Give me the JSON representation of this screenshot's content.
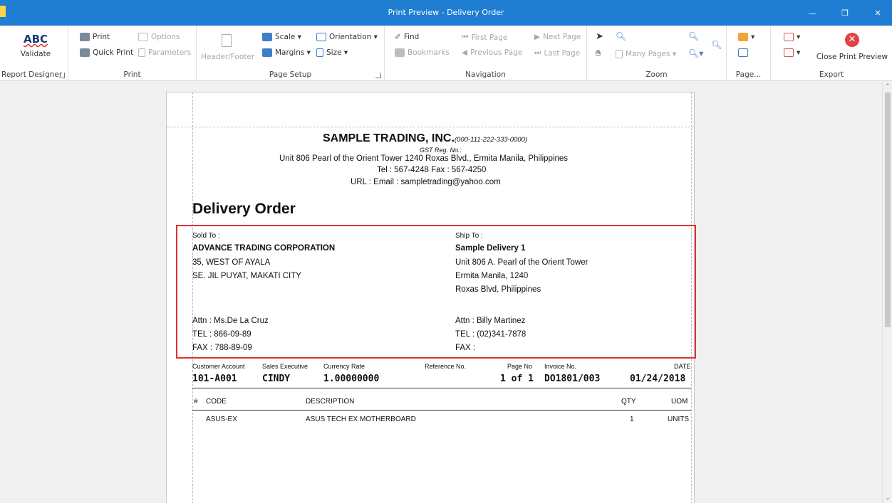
{
  "window": {
    "title": "Print Preview - Delivery Order",
    "controls": {
      "minimize": "—",
      "restore": "❐",
      "close": "✕"
    }
  },
  "ribbon": {
    "groups": {
      "report_designer": {
        "label": "Report Designer",
        "validate_abc": "ABC",
        "validate_label": "Validate"
      },
      "print": {
        "label": "Print",
        "print": "Print",
        "quick_print": "Quick Print",
        "options": "Options",
        "parameters": "Parameters"
      },
      "page_setup": {
        "label": "Page Setup",
        "header_footer": "Header/Footer",
        "scale": "Scale ▾",
        "margins": "Margins ▾",
        "orientation": "Orientation ▾",
        "size": "Size ▾"
      },
      "navigation": {
        "label": "Navigation",
        "find": "Find",
        "bookmarks": "Bookmarks",
        "first_page": "First Page",
        "previous_page": "Previous Page",
        "next_page": "Next Page",
        "last_page": "Last Page"
      },
      "zoom": {
        "label": "Zoom",
        "many_pages": "Many Pages ▾"
      },
      "page_background": {
        "label": "Page..."
      },
      "export": {
        "label": "Export",
        "close_preview": "Close Print Preview"
      }
    }
  },
  "document": {
    "company_name": "SAMPLE TRADING, INC.",
    "company_phone": "(000-111-222-333-0000)",
    "gst": "GST Reg. No.:",
    "address": "Unit 806 Pearl of the Orient Tower 1240 Roxas Blvd., Ermita Manila, Philippines",
    "tel_fax": "Tel : 567-4248  Fax : 567-4250",
    "url_email": "URL :      Email : sampletrading@yahoo.com",
    "title": "Delivery Order",
    "sold_to": {
      "label": "Sold To :",
      "name": "ADVANCE TRADING CORPORATION",
      "line1": "35, WEST OF AYALA",
      "line2": "SE. JIL PUYAT, MAKATI CITY",
      "attn": "Attn : Ms.De La Cruz",
      "tel": "TEL : 866-09-89",
      "fax": "FAX : 788-89-09"
    },
    "ship_to": {
      "label": "Ship To :",
      "name": "Sample Delivery 1",
      "line1": "Unit 806 A. Pearl of the Orient Tower",
      "line2": "Ermita Manila, 1240",
      "line3": "Roxas Blvd, Philippines",
      "attn": "Attn : Billy Martinez",
      "tel": "TEL : (02)341-7878",
      "fax": "FAX :"
    },
    "header": {
      "labels": {
        "customer_account": "Customer Account",
        "sales_executive": "Sales Executive",
        "currency_rate": "Currency Rate",
        "reference_no": "Reference No.",
        "page_no": "Page No",
        "invoice_no": "Invoice No.",
        "date": "DATE"
      },
      "values": {
        "customer_account": "101-A001",
        "sales_executive": "CINDY",
        "currency_rate": "1.00000000",
        "reference_no": "",
        "page_no": "1 of 1",
        "invoice_no": "DO1801/003",
        "date": "01/24/2018"
      }
    },
    "table": {
      "columns": {
        "num": "#",
        "code": "CODE",
        "description": "DESCRIPTION",
        "qty": "QTY",
        "uom": "UOM"
      },
      "rows": [
        {
          "code": "ASUS-EX",
          "description": "ASUS TECH EX MOTHERBOARD",
          "qty": "1",
          "uom": "UNITS"
        }
      ]
    }
  },
  "colors": {
    "titlebar": "#1f7ed1",
    "highlight_box": "#e03030",
    "close_preview_icon": "#e04343"
  }
}
